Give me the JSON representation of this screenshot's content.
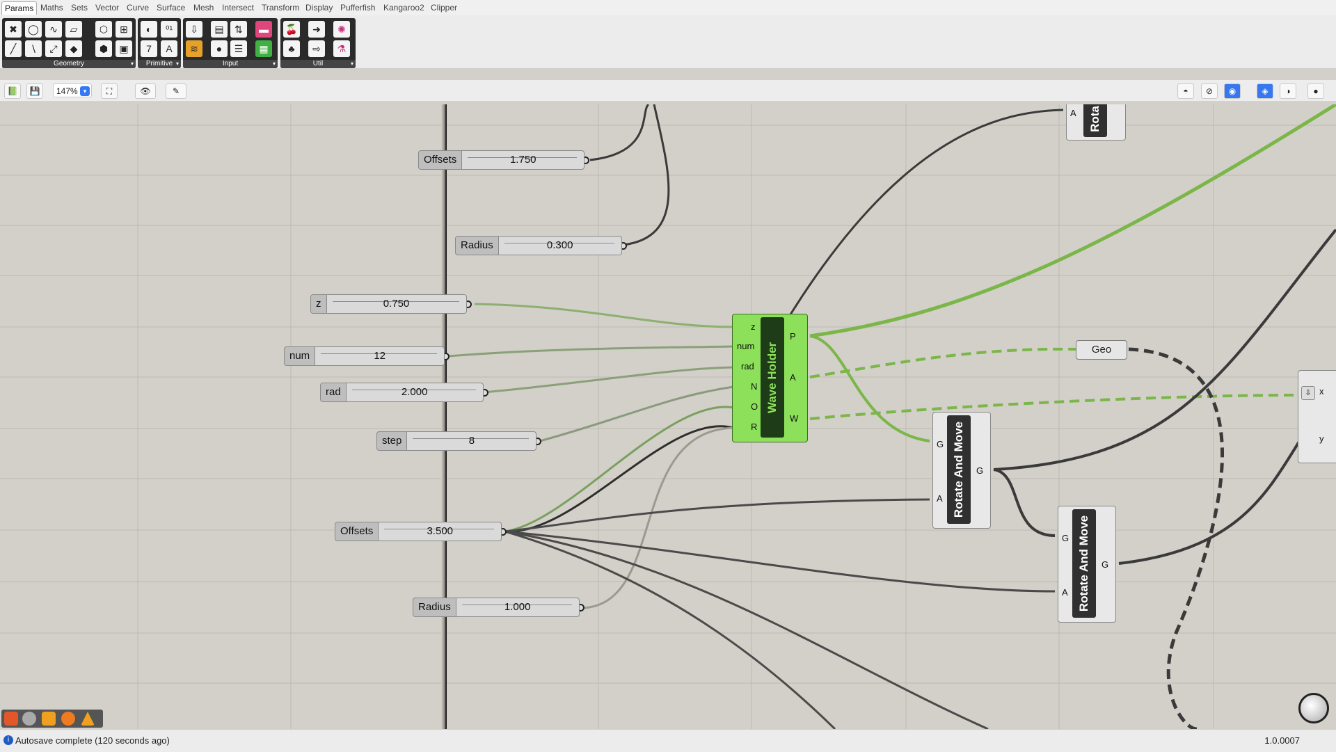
{
  "tabs": [
    "Params",
    "Maths",
    "Sets",
    "Vector",
    "Curve",
    "Surface",
    "Mesh",
    "Intersect",
    "Transform",
    "Display",
    "Pufferfish",
    "Kangaroo2",
    "Clipper"
  ],
  "ribbon": {
    "panels": [
      {
        "label": "Geometry"
      },
      {
        "label": "Primitive"
      },
      {
        "label": "Input"
      },
      {
        "label": "Util"
      }
    ]
  },
  "toolbar": {
    "zoom": "147%"
  },
  "canvas": {
    "sliders": [
      {
        "name": "Offsets",
        "value": "1.750"
      },
      {
        "name": "Radius",
        "value": "0.300"
      },
      {
        "name": "z",
        "value": "0.750"
      },
      {
        "name": "num",
        "value": "12"
      },
      {
        "name": "rad",
        "value": "2.000"
      },
      {
        "name": "step",
        "value": "8"
      },
      {
        "name": "Offsets",
        "value": "3.500"
      },
      {
        "name": "Radius",
        "value": "1.000"
      }
    ],
    "wave_holder": {
      "title": "Wave Holder",
      "inputs": [
        "z",
        "num",
        "rad",
        "N",
        "O",
        "R"
      ],
      "outputs": [
        "P",
        "A",
        "W"
      ]
    },
    "rotate_move_1": {
      "title": "Rotate And Move",
      "inputs": [
        "G",
        "A"
      ],
      "outputs": [
        "G"
      ]
    },
    "rotate_move_2": {
      "title": "Rotate And Move",
      "inputs": [
        "G",
        "A"
      ],
      "outputs": [
        "G"
      ]
    },
    "rotate_top": {
      "title": "Rota",
      "inputs": [
        "A"
      ]
    },
    "geo": "Geo",
    "right_comp": {
      "inputs": [
        "x",
        "y"
      ]
    }
  },
  "status": {
    "message": "Autosave complete (120 seconds ago)",
    "version": "1.0.0007"
  },
  "colors": {
    "wire_green": "#7ab648",
    "wire_dark": "#3a3a3a",
    "wire_grey": "#8a8a7e",
    "component_green": "#8ce05a"
  }
}
